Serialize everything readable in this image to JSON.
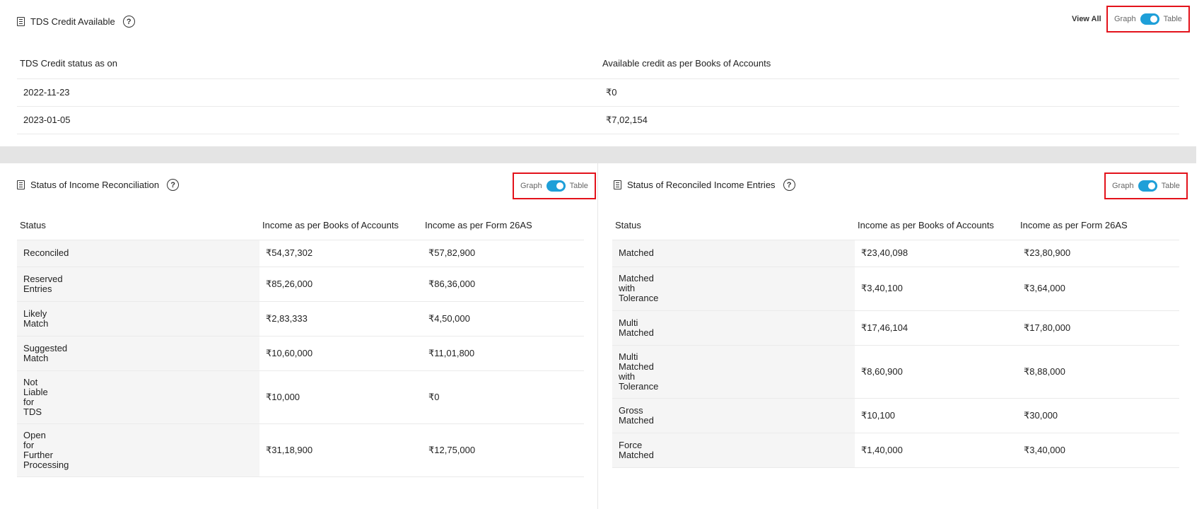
{
  "tds_credit": {
    "title": "TDS Credit Available",
    "view_all": "View All",
    "toggle": {
      "left": "Graph",
      "right": "Table"
    },
    "columns": [
      "TDS Credit status as on",
      "Available credit as per Books of Accounts"
    ],
    "rows": [
      [
        "2022-11-23",
        "₹0"
      ],
      [
        "2023-01-05",
        "₹7,02,154"
      ]
    ]
  },
  "income_reconciliation": {
    "title": "Status of Income Reconciliation",
    "toggle": {
      "left": "Graph",
      "right": "Table"
    },
    "columns": [
      "Status",
      "Income as per Books of Accounts",
      "Income as per Form 26AS"
    ],
    "rows": [
      {
        "status": [
          "Reconciled"
        ],
        "books": "₹54,37,302",
        "form26as": "₹57,82,900"
      },
      {
        "status": [
          "Reserved",
          "Entries"
        ],
        "books": "₹85,26,000",
        "form26as": "₹86,36,000"
      },
      {
        "status": [
          "Likely",
          "Match"
        ],
        "books": "₹2,83,333",
        "form26as": "₹4,50,000"
      },
      {
        "status": [
          "Suggested",
          "Match"
        ],
        "books": "₹10,60,000",
        "form26as": "₹11,01,800"
      },
      {
        "status": [
          "Not",
          "Liable",
          "for",
          "TDS"
        ],
        "books": "₹10,000",
        "form26as": "₹0"
      },
      {
        "status": [
          "Open",
          "for",
          "Further",
          "Processing"
        ],
        "books": "₹31,18,900",
        "form26as": "₹12,75,000"
      }
    ]
  },
  "reconciled_entries": {
    "title": "Status of Reconciled Income Entries",
    "toggle": {
      "left": "Graph",
      "right": "Table"
    },
    "columns": [
      "Status",
      "Income as per Books of Accounts",
      "Income as per Form 26AS"
    ],
    "rows": [
      {
        "status": [
          "Matched"
        ],
        "books": "₹23,40,098",
        "form26as": "₹23,80,900"
      },
      {
        "status": [
          "Matched",
          "with",
          "Tolerance"
        ],
        "books": "₹3,40,100",
        "form26as": "₹3,64,000"
      },
      {
        "status": [
          "Multi",
          "Matched"
        ],
        "books": "₹17,46,104",
        "form26as": "₹17,80,000"
      },
      {
        "status": [
          "Multi",
          "Matched",
          "with",
          "Tolerance"
        ],
        "books": "₹8,60,900",
        "form26as": "₹8,88,000"
      },
      {
        "status": [
          "Gross",
          "Matched"
        ],
        "books": "₹10,100",
        "form26as": "₹30,000"
      },
      {
        "status": [
          "Force",
          "Matched"
        ],
        "books": "₹1,40,000",
        "form26as": "₹3,40,000"
      }
    ]
  },
  "colors": {
    "toggle_on": "#1e9fd8",
    "highlight_border": "#e3121b",
    "divider_band": "#e4e4e4"
  }
}
